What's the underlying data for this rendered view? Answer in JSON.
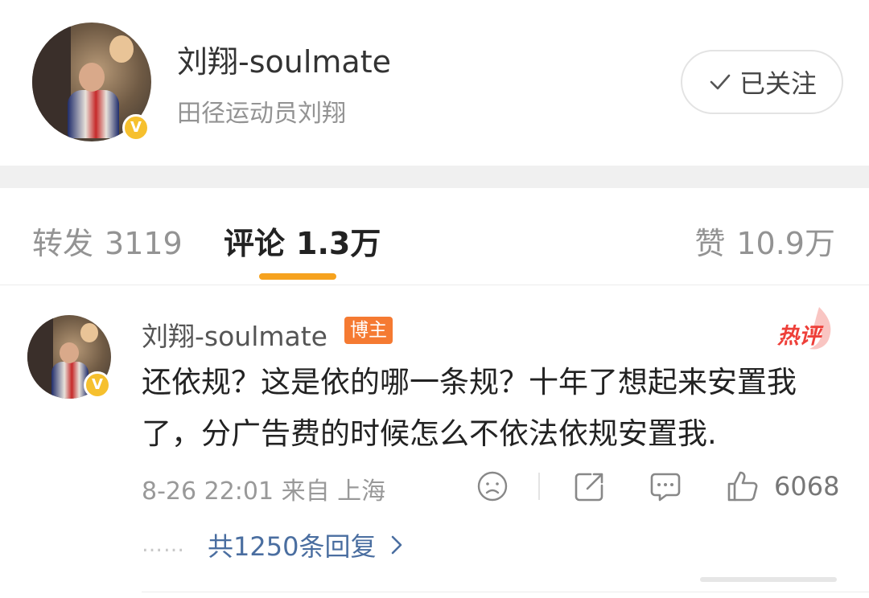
{
  "header": {
    "name": "刘翔-soulmate",
    "description": "田径运动员刘翔",
    "verified_badge": "V",
    "follow_button_label": "已关注",
    "follow_icon": "check-icon"
  },
  "tabs": {
    "repost_label": "转发",
    "repost_count": "3119",
    "comments_label": "评论",
    "comments_count": "1.3万",
    "likes_label": "赞",
    "likes_count": "10.9万",
    "active_tab": "comments",
    "indicator_color": "#f6a21e"
  },
  "comment": {
    "author": "刘翔-soulmate",
    "author_badge": "博主",
    "hot_badge": "热评",
    "verified_badge": "V",
    "text": "还依规？这是依的哪一条规？十年了想起来安置我了，分广告费的时候怎么不依法依规安置我.",
    "meta": "8-26 22:01 来自 上海",
    "like_count": "6068",
    "replies_dots": "……",
    "replies_label": "共1250条回复",
    "icons": [
      "sad-emoji-icon",
      "share-icon",
      "comment-icon",
      "thumbs-up-icon",
      "chevron-right-icon"
    ]
  },
  "colors": {
    "accent": "#f6a21e",
    "author_badge_bg": "#f57a32",
    "hot_red": "#ee3f39",
    "link_blue": "#4a6ea0",
    "verified_gold": "#f6c02e"
  }
}
